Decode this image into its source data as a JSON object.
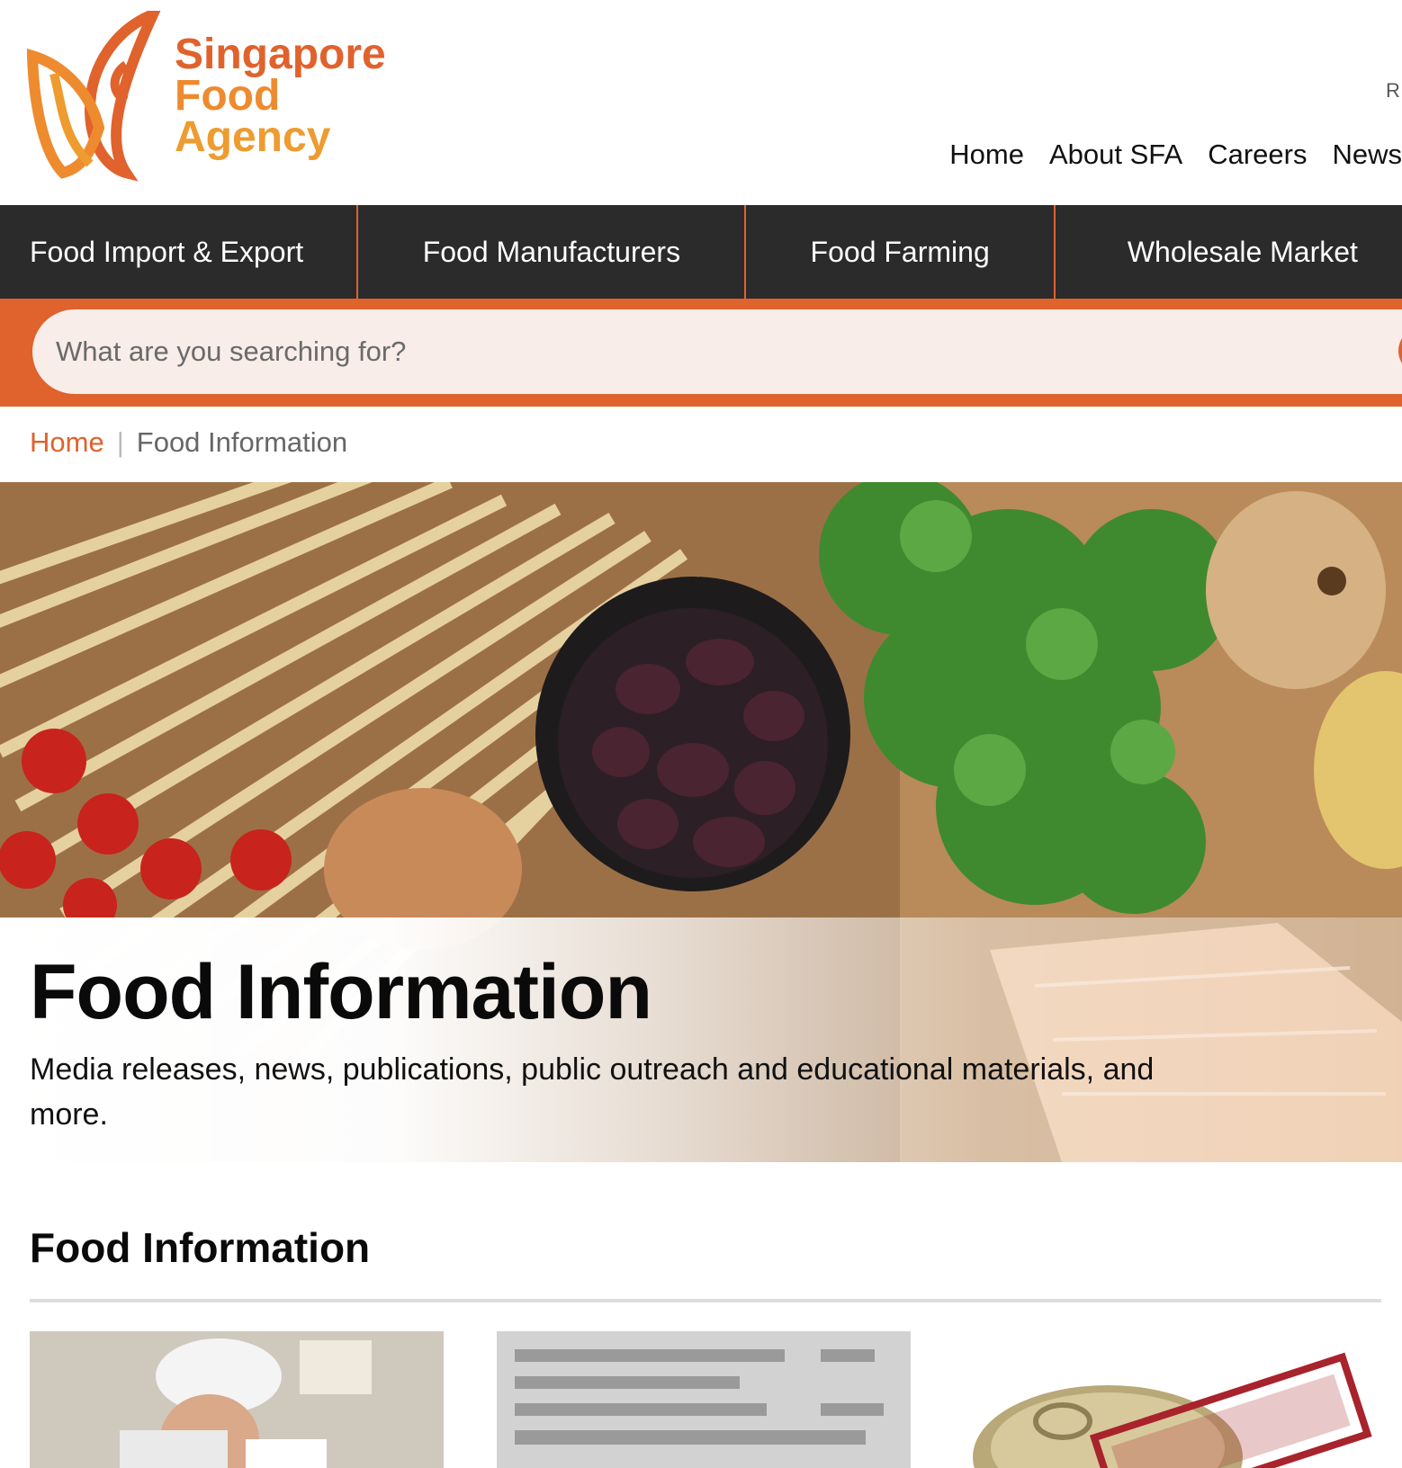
{
  "brand": {
    "line1": "Singapore",
    "line2": "Food",
    "line3": "Agency"
  },
  "header": {
    "utility_link": "R",
    "topnav": [
      "Home",
      "About SFA",
      "Careers",
      "News"
    ]
  },
  "mainnav": [
    "Food Import & Export",
    "Food Manufacturers",
    "Food Farming",
    "Wholesale Market"
  ],
  "search": {
    "placeholder": "What are you searching for?"
  },
  "breadcrumb": {
    "home": "Home",
    "separator": "|",
    "current": "Food Information"
  },
  "hero": {
    "title": "Food Information",
    "subtitle": "Media releases, news, publications, public outreach and educational materials, and more."
  },
  "section": {
    "title": "Food Information"
  },
  "cards": [
    {
      "image": "inspector-photo"
    },
    {
      "image": "nutrition-label-photo"
    },
    {
      "image": "recalled-can-photo"
    }
  ],
  "colors": {
    "accent": "#e0622c",
    "nav_bg": "#2b2b2b",
    "search_bg": "#f8ede8"
  }
}
